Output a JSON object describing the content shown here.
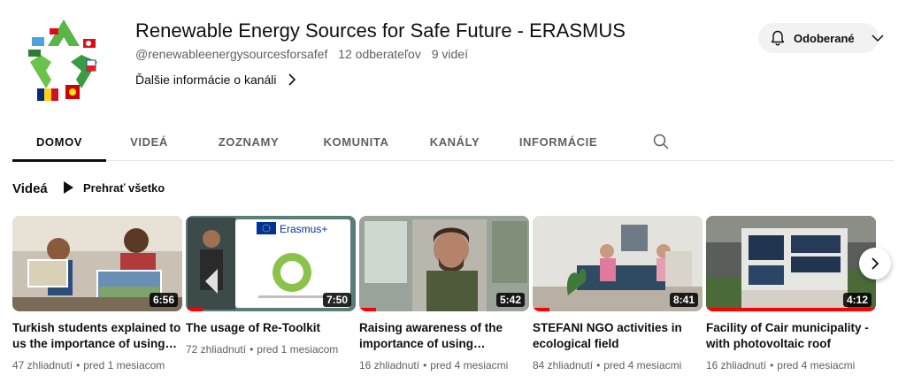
{
  "channel": {
    "title": "Renewable Energy Sources for Safe Future - ERASMUS",
    "handle": "@renewableenergysourcesforsafef",
    "subscribers": "12 odberateľov",
    "videos_count": "9 videí",
    "more_info": "Ďalšie informácie o kanáli",
    "subscribe_label": "Odoberané"
  },
  "tabs": [
    {
      "label": "DOMOV",
      "active": true
    },
    {
      "label": "VIDEÁ",
      "active": false
    },
    {
      "label": "ZOZNAMY",
      "active": false
    },
    {
      "label": "KOMUNITA",
      "active": false
    },
    {
      "label": "KANÁLY",
      "active": false
    },
    {
      "label": "INFORMÁCIE",
      "active": false
    }
  ],
  "section": {
    "title": "Videá",
    "play_all": "Prehrať všetko"
  },
  "videos": [
    {
      "title": "Turkish students explained to us the importance of using…",
      "duration": "6:56",
      "views": "47 zhliadnutí",
      "age": "pred 1 mesiacom",
      "watched_fraction": 0
    },
    {
      "title": "The usage of Re-Toolkit",
      "duration": "7:50",
      "views": "72 zhliadnutí",
      "age": "pred 1 mesiacom",
      "watched_fraction": 0.1,
      "thumb_text": "Erasmus+"
    },
    {
      "title": "Raising awareness of the importance of using…",
      "duration": "5:42",
      "views": "16 zhliadnutí",
      "age": "pred 4 mesiacmi",
      "watched_fraction": 0.1
    },
    {
      "title": "STEFANI NGO activities in ecological field",
      "duration": "8:41",
      "views": "84 zhliadnutí",
      "age": "pred 4 mesiacmi",
      "watched_fraction": 0.1
    },
    {
      "title": "Facility of Cair municipality - with photovoltaic roof",
      "duration": "4:12",
      "views": "16 zhliadnutí",
      "age": "pred 4 mesiacmi",
      "watched_fraction": 1
    }
  ],
  "icons": {
    "bell": "bell-icon",
    "chevron_down": "chevron-down-icon",
    "chevron_right": "chevron-right-icon",
    "search": "search-icon",
    "play": "play-icon"
  },
  "colors": {
    "progress": "#ff0000",
    "tab_active": "#0f0f0f",
    "secondary_text": "#606060"
  }
}
